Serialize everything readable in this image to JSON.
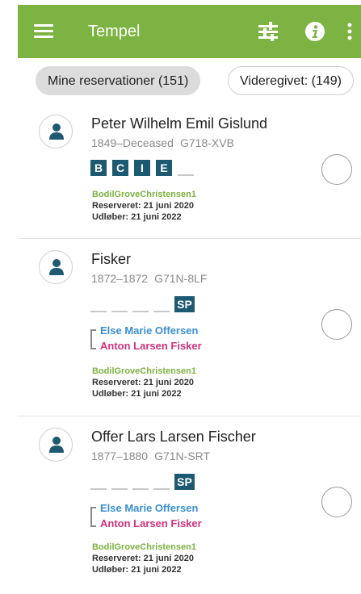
{
  "appbar": {
    "title": "Tempel",
    "menu_icon": "hamburger-menu-icon",
    "filter_icon": "tune-icon",
    "info_icon": "info-icon",
    "more_icon": "more-vert-icon",
    "color": "#7cb342"
  },
  "tabs": {
    "mine": "Mine reservationer (151)",
    "shared": "Videregivet: (149)"
  },
  "cards": [
    {
      "name": "Peter Wilhelm Emil Gislund",
      "dates": "1849–Deceased",
      "pid": "G718-XVB",
      "ordinances": [
        "B",
        "C",
        "I",
        "E"
      ],
      "owner": "BodilGroveChristensen1",
      "reserved": "Reserveret: 21 juni 2020",
      "expires": "Udløber: 21 juni 2022"
    },
    {
      "name": "Fisker",
      "dates": "1872–1872",
      "pid": "G71N-8LF",
      "ordinances": [
        "SP"
      ],
      "spouse": "Else Marie Offersen",
      "husband": "Anton Larsen Fisker",
      "owner": "BodilGroveChristensen1",
      "reserved": "Reserveret: 21 juni 2020",
      "expires": "Udløber: 21 juni 2022"
    },
    {
      "name": "Offer Lars Larsen Fischer",
      "dates": "1877–1880",
      "pid": "G71N-SRT",
      "ordinances": [
        "SP"
      ],
      "spouse": "Else Marie Offersen",
      "husband": "Anton Larsen Fisker",
      "owner": "BodilGroveChristensen1",
      "reserved": "Reserveret: 21 juni 2020",
      "expires": "Udløber: 21 juni 2022"
    }
  ],
  "colors": {
    "ordinance_bg": "#1d5a72",
    "owner": "#7cb342",
    "spouse": "#3a8fd0",
    "husband": "#d0327c"
  }
}
